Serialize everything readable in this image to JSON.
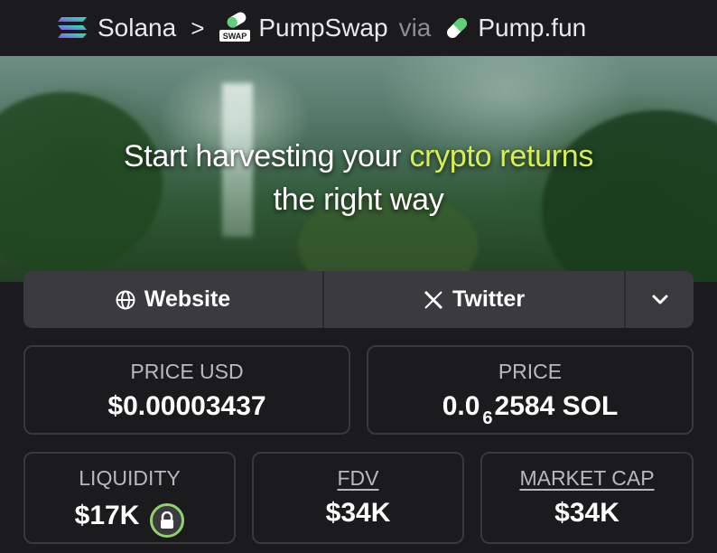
{
  "breadcrumb": {
    "chain": "Solana",
    "separator": ">",
    "dex": "PumpSwap",
    "dex_badge": "SWAP",
    "via": "via",
    "launchpad": "Pump.fun"
  },
  "banner": {
    "line1_prefix": "Start harvesting your ",
    "line1_highlight": "crypto returns",
    "line2": "the right way",
    "highlight_color": "#d7ee54"
  },
  "links": {
    "website_label": "Website",
    "website_icon": "globe-icon",
    "twitter_label": "Twitter",
    "twitter_icon": "x-logo-icon",
    "more_icon": "chevron-down-icon"
  },
  "stats": {
    "price_usd": {
      "label": "PRICE USD",
      "value": "$0.00003437"
    },
    "price": {
      "label": "PRICE",
      "value_prefix": "0.0",
      "value_subscript": "6",
      "value_suffix": "2584 SOL"
    },
    "liquidity": {
      "label": "LIQUIDITY",
      "value": "$17K",
      "icon": "lock-icon"
    },
    "fdv": {
      "label": "FDV",
      "value": "$34K"
    },
    "market_cap": {
      "label": "MARKET CAP",
      "value": "$34K"
    }
  }
}
